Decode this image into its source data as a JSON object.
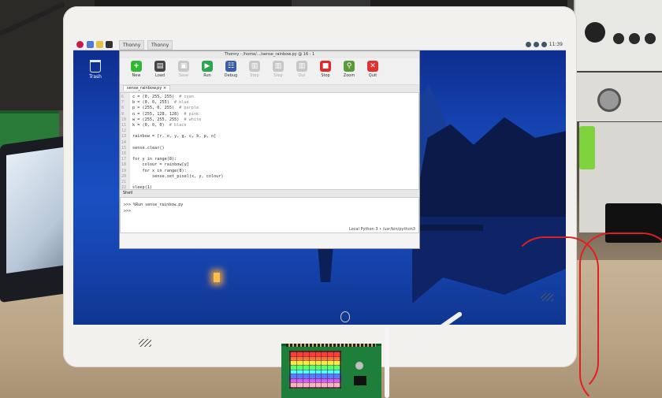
{
  "taskbar": {
    "tasks": [
      "Thonny",
      "Thonny"
    ],
    "clock": "11:39"
  },
  "desktop": {
    "trash_label": "Trash"
  },
  "thonny": {
    "window_title": "Thonny - /home/.../sense_rainbow.py @ 16 : 1",
    "toolbar": [
      {
        "label": "New",
        "icon": "plus-icon",
        "color": "#33b633",
        "enabled": true
      },
      {
        "label": "Load",
        "icon": "folder-icon",
        "color": "#444444",
        "enabled": true
      },
      {
        "label": "Save",
        "icon": "save-icon",
        "color": "#c7c7c7",
        "enabled": false
      },
      {
        "label": "Run",
        "icon": "play-icon",
        "color": "#2fa44f",
        "enabled": true
      },
      {
        "label": "Debug",
        "icon": "debug-icon",
        "color": "#3a5ea8",
        "enabled": true
      },
      {
        "label": "Step",
        "icon": "step-over-icon",
        "color": "#c7c7c7",
        "enabled": false
      },
      {
        "label": "Step",
        "icon": "step-into-icon",
        "color": "#c7c7c7",
        "enabled": false
      },
      {
        "label": "Out",
        "icon": "step-out-icon",
        "color": "#c7c7c7",
        "enabled": false
      },
      {
        "label": "Stop",
        "icon": "stop-icon",
        "color": "#e02a2a",
        "enabled": true
      },
      {
        "label": "Zoom",
        "icon": "zoom-icon",
        "color": "#5a9a3a",
        "enabled": true
      },
      {
        "label": "Quit",
        "icon": "quit-icon",
        "color": "#e03030",
        "enabled": true
      }
    ],
    "editor_tab": "sense_rainbow.py ×",
    "code_lines": [
      {
        "no": "6",
        "code": "c = (0, 255, 255)",
        "comment": "# cyan"
      },
      {
        "no": "7",
        "code": "b = (0, 0, 255)",
        "comment": "# blue"
      },
      {
        "no": "8",
        "code": "p = (255, 0, 255)",
        "comment": "# purple"
      },
      {
        "no": "9",
        "code": "n = (255, 128, 128)",
        "comment": "# pink"
      },
      {
        "no": "10",
        "code": "w = (255, 255, 255)",
        "comment": "# white"
      },
      {
        "no": "11",
        "code": "k = (0, 0, 0)",
        "comment": "# black"
      },
      {
        "no": "12",
        "code": "",
        "comment": ""
      },
      {
        "no": "13",
        "code": "rainbow = [r, o, y, g, c, b, p, n]",
        "comment": ""
      },
      {
        "no": "14",
        "code": "",
        "comment": ""
      },
      {
        "no": "15",
        "code": "sense.clear()",
        "comment": ""
      },
      {
        "no": "16",
        "code": "",
        "comment": ""
      },
      {
        "no": "17",
        "code": "for y in range(8):",
        "comment": ""
      },
      {
        "no": "18",
        "code": "    colour = rainbow[y]",
        "comment": ""
      },
      {
        "no": "19",
        "code": "    for x in range(8):",
        "comment": ""
      },
      {
        "no": "20",
        "code": "        sense.set_pixel(x, y, colour)",
        "comment": ""
      },
      {
        "no": "21",
        "code": "",
        "comment": ""
      },
      {
        "no": "22",
        "code": "sleep(1)",
        "comment": ""
      }
    ],
    "shell_tab": "Shell",
    "shell_lines": [
      ">>> %Run sense_rainbow.py",
      ">>>"
    ],
    "status": "Local Python 3 • /usr/bin/python3"
  },
  "sense_hat": {
    "led_rows": [
      "#ff3a3a",
      "#ff6a3a",
      "#ffe84a",
      "#5aff6a",
      "#5affff",
      "#5a7aff",
      "#d05aff",
      "#ffb0c0"
    ]
  }
}
